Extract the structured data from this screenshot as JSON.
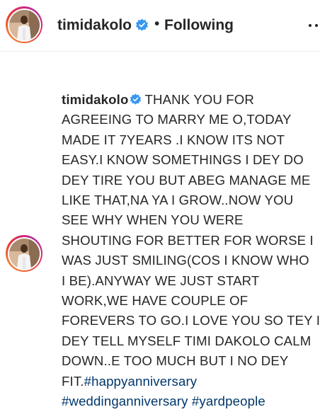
{
  "post": {
    "username": "timidakolo",
    "separator": "•",
    "follow_status": "Following"
  },
  "caption": {
    "username": "timidakolo",
    "lines": [
      "THANK YOU FOR",
      "AGREEING TO MARRY ME O,TODAY",
      "MADE IT 7YEARS .I KNOW ITS NOT",
      "EASY.I KNOW SOMETHINGS I DEY DO",
      "DEY TIRE YOU BUT ABEG MANAGE ME",
      "LIKE THAT,NA YA I GROW..NOW YOU",
      "SEE WHY WHEN YOU WERE",
      "SHOUTING FOR BETTER FOR WORSE I",
      "WAS JUST SMILING(COS I KNOW WHO",
      "I BE).ANYWAY WE JUST START",
      "WORK,WE HAVE COUPLE OF",
      "FOREVERS TO GO.I LOVE YOU SO TEY I",
      "DEY TELL MYSELF TIMI DAKOLO CALM",
      "DOWN..E TOO MUCH BUT I NO DEY",
      "FIT."
    ],
    "hashtags": [
      "#happyanniversary",
      "#weddinganniversary",
      "#yardpeople"
    ]
  },
  "icons": {
    "verified": "verified-badge-icon",
    "more": "more-options-icon"
  },
  "colors": {
    "verified_blue": "#3897f0",
    "hashtag": "#00376b",
    "text": "#262626",
    "divider": "#efefef"
  }
}
